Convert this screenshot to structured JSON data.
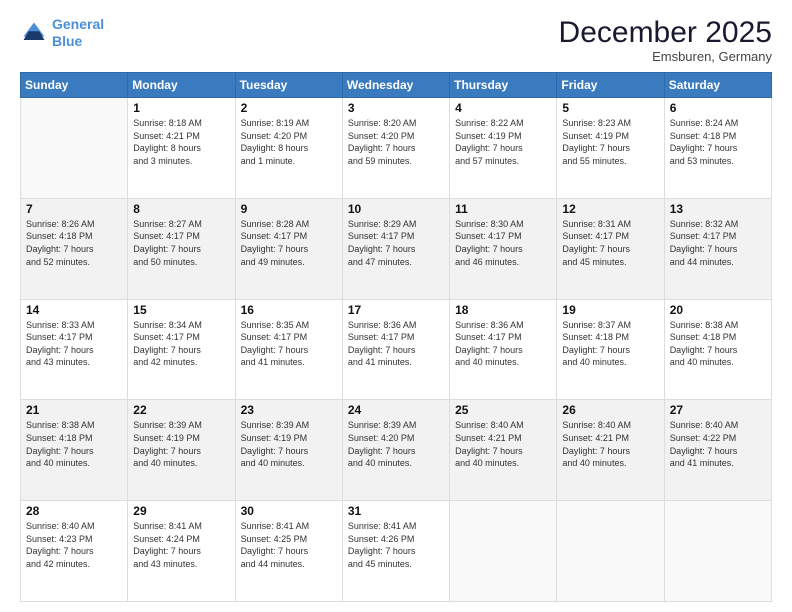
{
  "header": {
    "logo_line1": "General",
    "logo_line2": "Blue",
    "month": "December 2025",
    "location": "Emsburen, Germany"
  },
  "weekdays": [
    "Sunday",
    "Monday",
    "Tuesday",
    "Wednesday",
    "Thursday",
    "Friday",
    "Saturday"
  ],
  "weeks": [
    [
      {
        "day": "",
        "text": ""
      },
      {
        "day": "1",
        "text": "Sunrise: 8:18 AM\nSunset: 4:21 PM\nDaylight: 8 hours\nand 3 minutes."
      },
      {
        "day": "2",
        "text": "Sunrise: 8:19 AM\nSunset: 4:20 PM\nDaylight: 8 hours\nand 1 minute."
      },
      {
        "day": "3",
        "text": "Sunrise: 8:20 AM\nSunset: 4:20 PM\nDaylight: 7 hours\nand 59 minutes."
      },
      {
        "day": "4",
        "text": "Sunrise: 8:22 AM\nSunset: 4:19 PM\nDaylight: 7 hours\nand 57 minutes."
      },
      {
        "day": "5",
        "text": "Sunrise: 8:23 AM\nSunset: 4:19 PM\nDaylight: 7 hours\nand 55 minutes."
      },
      {
        "day": "6",
        "text": "Sunrise: 8:24 AM\nSunset: 4:18 PM\nDaylight: 7 hours\nand 53 minutes."
      }
    ],
    [
      {
        "day": "7",
        "text": "Sunrise: 8:26 AM\nSunset: 4:18 PM\nDaylight: 7 hours\nand 52 minutes."
      },
      {
        "day": "8",
        "text": "Sunrise: 8:27 AM\nSunset: 4:17 PM\nDaylight: 7 hours\nand 50 minutes."
      },
      {
        "day": "9",
        "text": "Sunrise: 8:28 AM\nSunset: 4:17 PM\nDaylight: 7 hours\nand 49 minutes."
      },
      {
        "day": "10",
        "text": "Sunrise: 8:29 AM\nSunset: 4:17 PM\nDaylight: 7 hours\nand 47 minutes."
      },
      {
        "day": "11",
        "text": "Sunrise: 8:30 AM\nSunset: 4:17 PM\nDaylight: 7 hours\nand 46 minutes."
      },
      {
        "day": "12",
        "text": "Sunrise: 8:31 AM\nSunset: 4:17 PM\nDaylight: 7 hours\nand 45 minutes."
      },
      {
        "day": "13",
        "text": "Sunrise: 8:32 AM\nSunset: 4:17 PM\nDaylight: 7 hours\nand 44 minutes."
      }
    ],
    [
      {
        "day": "14",
        "text": "Sunrise: 8:33 AM\nSunset: 4:17 PM\nDaylight: 7 hours\nand 43 minutes."
      },
      {
        "day": "15",
        "text": "Sunrise: 8:34 AM\nSunset: 4:17 PM\nDaylight: 7 hours\nand 42 minutes."
      },
      {
        "day": "16",
        "text": "Sunrise: 8:35 AM\nSunset: 4:17 PM\nDaylight: 7 hours\nand 41 minutes."
      },
      {
        "day": "17",
        "text": "Sunrise: 8:36 AM\nSunset: 4:17 PM\nDaylight: 7 hours\nand 41 minutes."
      },
      {
        "day": "18",
        "text": "Sunrise: 8:36 AM\nSunset: 4:17 PM\nDaylight: 7 hours\nand 40 minutes."
      },
      {
        "day": "19",
        "text": "Sunrise: 8:37 AM\nSunset: 4:18 PM\nDaylight: 7 hours\nand 40 minutes."
      },
      {
        "day": "20",
        "text": "Sunrise: 8:38 AM\nSunset: 4:18 PM\nDaylight: 7 hours\nand 40 minutes."
      }
    ],
    [
      {
        "day": "21",
        "text": "Sunrise: 8:38 AM\nSunset: 4:18 PM\nDaylight: 7 hours\nand 40 minutes."
      },
      {
        "day": "22",
        "text": "Sunrise: 8:39 AM\nSunset: 4:19 PM\nDaylight: 7 hours\nand 40 minutes."
      },
      {
        "day": "23",
        "text": "Sunrise: 8:39 AM\nSunset: 4:19 PM\nDaylight: 7 hours\nand 40 minutes."
      },
      {
        "day": "24",
        "text": "Sunrise: 8:39 AM\nSunset: 4:20 PM\nDaylight: 7 hours\nand 40 minutes."
      },
      {
        "day": "25",
        "text": "Sunrise: 8:40 AM\nSunset: 4:21 PM\nDaylight: 7 hours\nand 40 minutes."
      },
      {
        "day": "26",
        "text": "Sunrise: 8:40 AM\nSunset: 4:21 PM\nDaylight: 7 hours\nand 40 minutes."
      },
      {
        "day": "27",
        "text": "Sunrise: 8:40 AM\nSunset: 4:22 PM\nDaylight: 7 hours\nand 41 minutes."
      }
    ],
    [
      {
        "day": "28",
        "text": "Sunrise: 8:40 AM\nSunset: 4:23 PM\nDaylight: 7 hours\nand 42 minutes."
      },
      {
        "day": "29",
        "text": "Sunrise: 8:41 AM\nSunset: 4:24 PM\nDaylight: 7 hours\nand 43 minutes."
      },
      {
        "day": "30",
        "text": "Sunrise: 8:41 AM\nSunset: 4:25 PM\nDaylight: 7 hours\nand 44 minutes."
      },
      {
        "day": "31",
        "text": "Sunrise: 8:41 AM\nSunset: 4:26 PM\nDaylight: 7 hours\nand 45 minutes."
      },
      {
        "day": "",
        "text": ""
      },
      {
        "day": "",
        "text": ""
      },
      {
        "day": "",
        "text": ""
      }
    ]
  ]
}
